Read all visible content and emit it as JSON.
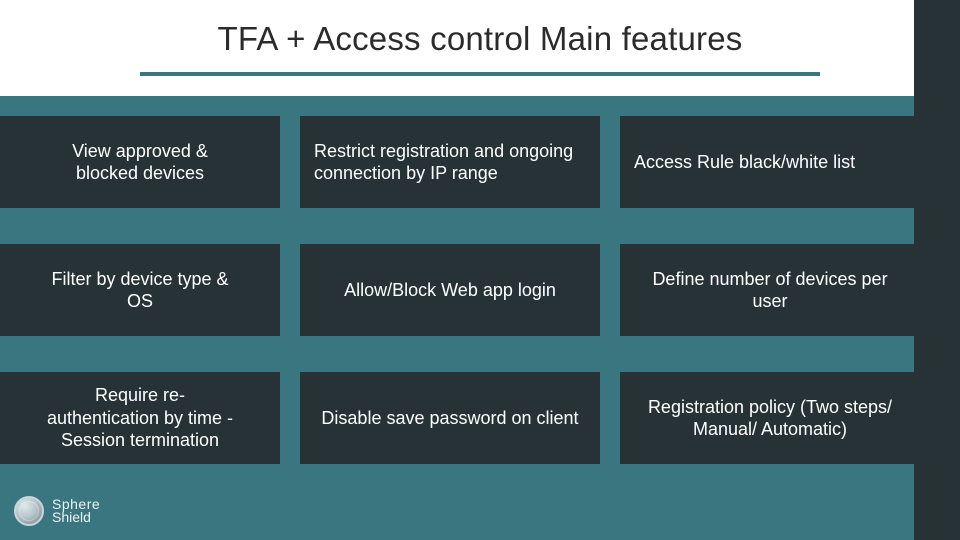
{
  "title": "TFA + Access control Main features",
  "cells": {
    "r1c1": "View approved & blocked devices",
    "r1c2": "Restrict registration and ongoing connection  by IP range",
    "r1c3": "Access Rule black/white list",
    "r2c1": "Filter by device type & OS",
    "r2c2": "Allow/Block Web app login",
    "r2c3": "Define number of devices per user",
    "r3c1": "Require re-authentication by time - Session termination",
    "r3c2": "Disable save password on client",
    "r3c3": "Registration policy (Two steps/ Manual/ Automatic)"
  },
  "brand": {
    "line1": "Sphere",
    "line2": "Shield"
  },
  "colors": {
    "background": "#397680",
    "cell": "#273237",
    "header_bg": "#ffffff",
    "text_light": "#ffffff",
    "text_dark": "#2b2b2b"
  }
}
